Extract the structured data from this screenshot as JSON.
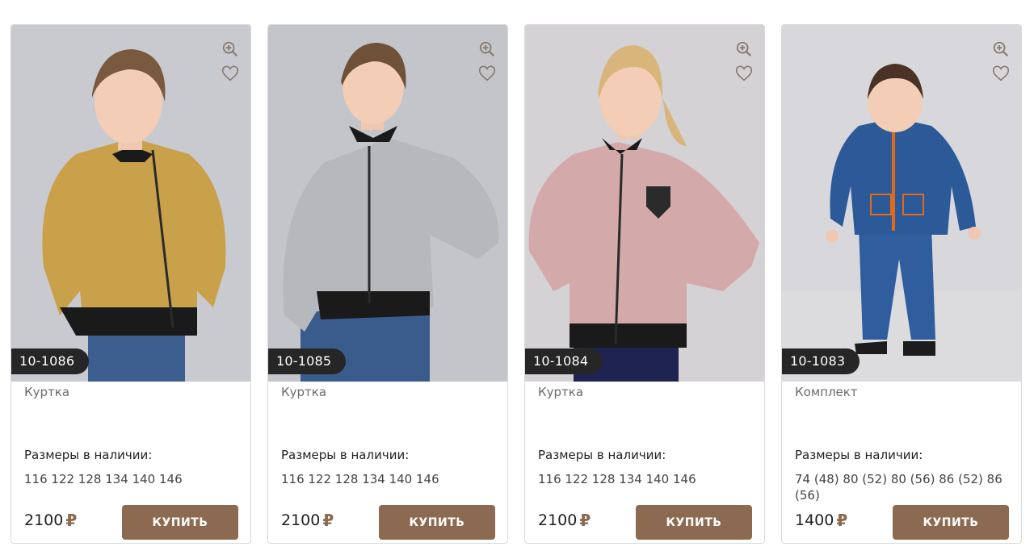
{
  "colors": {
    "accent": "#8c6a52",
    "sku_badge": "#262626",
    "border": "#d9d9d9"
  },
  "products": [
    {
      "sku": "10-1086",
      "name": "Куртка",
      "sizes_title": "Размеры в наличии:",
      "sizes": "116 122 128 134 140 146",
      "price": "2100",
      "currency": "₽",
      "buy_label": "КУПИТЬ",
      "icons": [
        "zoom-in-icon",
        "heart-icon"
      ],
      "image": "girl-gold-bomber-jacket"
    },
    {
      "sku": "10-1085",
      "name": "Куртка",
      "sizes_title": "Размеры в наличии:",
      "sizes": "116 122 128 134 140 146",
      "price": "2100",
      "currency": "₽",
      "buy_label": "КУПИТЬ",
      "icons": [
        "zoom-in-icon",
        "heart-icon"
      ],
      "image": "girl-silver-bomber-jacket"
    },
    {
      "sku": "10-1084",
      "name": "Куртка",
      "sizes_title": "Размеры в наличии:",
      "sizes": "116 122 128 134 140 146",
      "price": "2100",
      "currency": "₽",
      "buy_label": "КУПИТЬ",
      "icons": [
        "zoom-in-icon",
        "heart-icon"
      ],
      "image": "girl-pink-bomber-jacket"
    },
    {
      "sku": "10-1083",
      "name": "Комплект",
      "sizes_title": "Размеры в наличии:",
      "sizes": "74 (48) 80 (52) 80 (56) 86 (52) 86 (56)",
      "price": "1400",
      "currency": "₽",
      "buy_label": "КУПИТЬ",
      "icons": [
        "zoom-in-icon",
        "heart-icon"
      ],
      "image": "toddler-blue-winter-set"
    }
  ]
}
